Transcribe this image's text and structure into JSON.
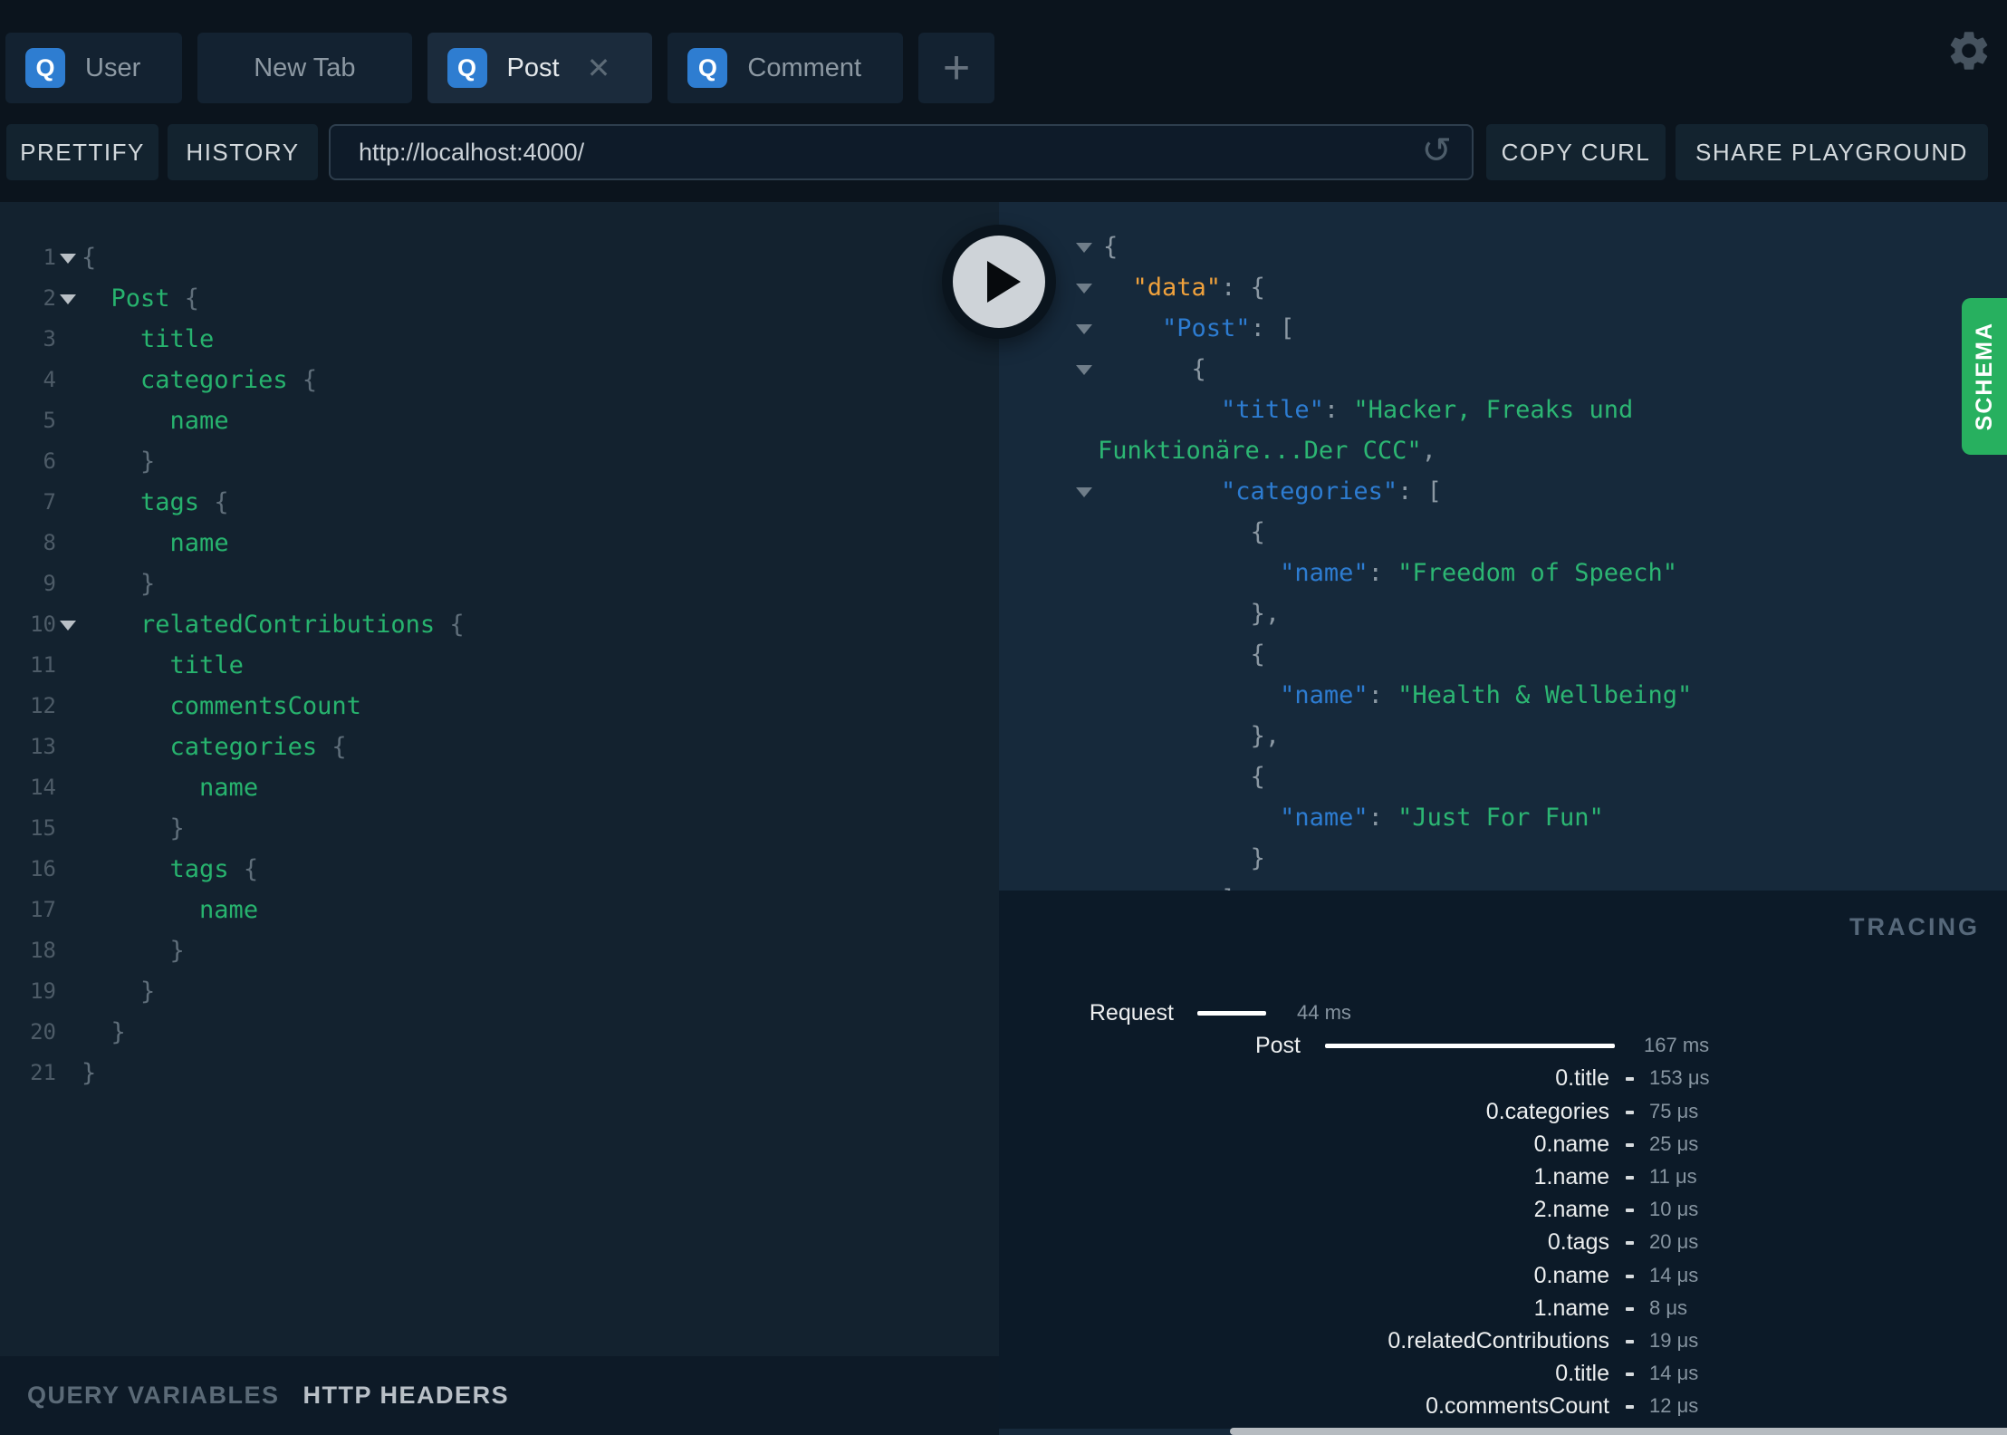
{
  "tabs": {
    "items": [
      {
        "label": "User",
        "badge": "Q",
        "closable": false,
        "active": false
      },
      {
        "label": "New Tab",
        "badge": null,
        "closable": false,
        "active": false
      },
      {
        "label": "Post",
        "badge": "Q",
        "closable": true,
        "active": true
      },
      {
        "label": "Comment",
        "badge": "Q",
        "closable": false,
        "active": false
      }
    ],
    "new_tab_button": "+"
  },
  "toolbar": {
    "prettify_label": "PRETTIFY",
    "history_label": "HISTORY",
    "url_value": "http://localhost:4000/",
    "copy_curl_label": "COPY CURL",
    "share_label": "SHARE PLAYGROUND"
  },
  "editor": {
    "lines": [
      {
        "n": 1,
        "arrow": true,
        "tokens": [
          [
            "pun",
            "{"
          ]
        ]
      },
      {
        "n": 2,
        "arrow": true,
        "tokens": [
          [
            "pln",
            "  "
          ],
          [
            "fld",
            "Post"
          ],
          [
            "pun",
            " {"
          ]
        ]
      },
      {
        "n": 3,
        "arrow": false,
        "tokens": [
          [
            "pln",
            "    "
          ],
          [
            "fld",
            "title"
          ]
        ]
      },
      {
        "n": 4,
        "arrow": false,
        "tokens": [
          [
            "pln",
            "    "
          ],
          [
            "fld",
            "categories"
          ],
          [
            "pun",
            " {"
          ]
        ]
      },
      {
        "n": 5,
        "arrow": false,
        "tokens": [
          [
            "pln",
            "      "
          ],
          [
            "fld",
            "name"
          ]
        ]
      },
      {
        "n": 6,
        "arrow": false,
        "tokens": [
          [
            "pln",
            "    "
          ],
          [
            "pun",
            "}"
          ]
        ]
      },
      {
        "n": 7,
        "arrow": false,
        "tokens": [
          [
            "pln",
            "    "
          ],
          [
            "fld",
            "tags"
          ],
          [
            "pun",
            " {"
          ]
        ]
      },
      {
        "n": 8,
        "arrow": false,
        "tokens": [
          [
            "pln",
            "      "
          ],
          [
            "fld",
            "name"
          ]
        ]
      },
      {
        "n": 9,
        "arrow": false,
        "tokens": [
          [
            "pln",
            "    "
          ],
          [
            "pun",
            "}"
          ]
        ]
      },
      {
        "n": 10,
        "arrow": true,
        "tokens": [
          [
            "pln",
            "    "
          ],
          [
            "fld",
            "relatedContributions"
          ],
          [
            "pun",
            " {"
          ]
        ]
      },
      {
        "n": 11,
        "arrow": false,
        "tokens": [
          [
            "pln",
            "      "
          ],
          [
            "fld",
            "title"
          ]
        ]
      },
      {
        "n": 12,
        "arrow": false,
        "tokens": [
          [
            "pln",
            "      "
          ],
          [
            "fld",
            "commentsCount"
          ]
        ]
      },
      {
        "n": 13,
        "arrow": false,
        "tokens": [
          [
            "pln",
            "      "
          ],
          [
            "fld",
            "categories"
          ],
          [
            "pun",
            " {"
          ]
        ]
      },
      {
        "n": 14,
        "arrow": false,
        "tokens": [
          [
            "pln",
            "        "
          ],
          [
            "fld",
            "name"
          ]
        ]
      },
      {
        "n": 15,
        "arrow": false,
        "tokens": [
          [
            "pln",
            "      "
          ],
          [
            "pun",
            "}"
          ]
        ]
      },
      {
        "n": 16,
        "arrow": false,
        "tokens": [
          [
            "pln",
            "      "
          ],
          [
            "fld",
            "tags"
          ],
          [
            "pun",
            " {"
          ]
        ]
      },
      {
        "n": 17,
        "arrow": false,
        "tokens": [
          [
            "pln",
            "        "
          ],
          [
            "fld",
            "name"
          ]
        ]
      },
      {
        "n": 18,
        "arrow": false,
        "tokens": [
          [
            "pln",
            "      "
          ],
          [
            "pun",
            "}"
          ]
        ]
      },
      {
        "n": 19,
        "arrow": false,
        "tokens": [
          [
            "pln",
            "    "
          ],
          [
            "pun",
            "}"
          ]
        ]
      },
      {
        "n": 20,
        "arrow": false,
        "tokens": [
          [
            "pln",
            "  "
          ],
          [
            "pun",
            "}"
          ]
        ]
      },
      {
        "n": 21,
        "arrow": false,
        "tokens": [
          [
            "pun",
            "}"
          ]
        ]
      }
    ]
  },
  "response": {
    "lines": [
      {
        "arrow": true,
        "wrap": false,
        "tokens": [
          [
            "pun",
            "{"
          ]
        ]
      },
      {
        "arrow": true,
        "wrap": false,
        "tokens": [
          [
            "pln",
            "  "
          ],
          [
            "dat",
            "\"data\""
          ],
          [
            "pun",
            ": {"
          ]
        ]
      },
      {
        "arrow": true,
        "wrap": false,
        "tokens": [
          [
            "pln",
            "    "
          ],
          [
            "key",
            "\"Post\""
          ],
          [
            "pun",
            ": ["
          ]
        ]
      },
      {
        "arrow": true,
        "wrap": false,
        "tokens": [
          [
            "pln",
            "      "
          ],
          [
            "pun",
            "{"
          ]
        ]
      },
      {
        "arrow": false,
        "wrap": false,
        "tokens": [
          [
            "pln",
            "        "
          ],
          [
            "key",
            "\"title\""
          ],
          [
            "pun",
            ": "
          ],
          [
            "str",
            "\"Hacker, Freaks und"
          ]
        ]
      },
      {
        "arrow": false,
        "wrap": true,
        "tokens": [
          [
            "str",
            "Funktionäre...Der CCC\""
          ],
          [
            "pun",
            ","
          ]
        ]
      },
      {
        "arrow": true,
        "wrap": false,
        "tokens": [
          [
            "pln",
            "        "
          ],
          [
            "key",
            "\"categories\""
          ],
          [
            "pun",
            ": ["
          ]
        ]
      },
      {
        "arrow": false,
        "wrap": false,
        "tokens": [
          [
            "pln",
            "          "
          ],
          [
            "pun",
            "{"
          ]
        ]
      },
      {
        "arrow": false,
        "wrap": false,
        "tokens": [
          [
            "pln",
            "            "
          ],
          [
            "key",
            "\"name\""
          ],
          [
            "pun",
            ": "
          ],
          [
            "str",
            "\"Freedom of Speech\""
          ]
        ]
      },
      {
        "arrow": false,
        "wrap": false,
        "tokens": [
          [
            "pln",
            "          "
          ],
          [
            "pun",
            "},"
          ]
        ]
      },
      {
        "arrow": false,
        "wrap": false,
        "tokens": [
          [
            "pln",
            "          "
          ],
          [
            "pun",
            "{"
          ]
        ]
      },
      {
        "arrow": false,
        "wrap": false,
        "tokens": [
          [
            "pln",
            "            "
          ],
          [
            "key",
            "\"name\""
          ],
          [
            "pun",
            ": "
          ],
          [
            "str",
            "\"Health & Wellbeing\""
          ]
        ]
      },
      {
        "arrow": false,
        "wrap": false,
        "tokens": [
          [
            "pln",
            "          "
          ],
          [
            "pun",
            "},"
          ]
        ]
      },
      {
        "arrow": false,
        "wrap": false,
        "tokens": [
          [
            "pln",
            "          "
          ],
          [
            "pun",
            "{"
          ]
        ]
      },
      {
        "arrow": false,
        "wrap": false,
        "tokens": [
          [
            "pln",
            "            "
          ],
          [
            "key",
            "\"name\""
          ],
          [
            "pun",
            ": "
          ],
          [
            "str",
            "\"Just For Fun\""
          ]
        ]
      },
      {
        "arrow": false,
        "wrap": false,
        "tokens": [
          [
            "pln",
            "          "
          ],
          [
            "pun",
            "}"
          ]
        ]
      },
      {
        "arrow": false,
        "wrap": false,
        "tokens": [
          [
            "pln",
            "        "
          ],
          [
            "pun",
            "]"
          ]
        ]
      }
    ]
  },
  "schema": {
    "label": "SCHEMA"
  },
  "tracing": {
    "title": "TRACING",
    "rows": [
      {
        "kind": "bar",
        "label": "Request",
        "value": "44 ms"
      },
      {
        "kind": "bar",
        "label": "Post",
        "value": "167 ms"
      },
      {
        "kind": "field",
        "label": "0.title",
        "value": "153 μs"
      },
      {
        "kind": "field",
        "label": "0.categories",
        "value": "75 μs"
      },
      {
        "kind": "field",
        "label": "0.name",
        "value": "25 μs"
      },
      {
        "kind": "field",
        "label": "1.name",
        "value": "11 μs"
      },
      {
        "kind": "field",
        "label": "2.name",
        "value": "10 μs"
      },
      {
        "kind": "field",
        "label": "0.tags",
        "value": "20 μs"
      },
      {
        "kind": "field",
        "label": "0.name",
        "value": "14 μs"
      },
      {
        "kind": "field",
        "label": "1.name",
        "value": "8 μs"
      },
      {
        "kind": "field",
        "label": "0.relatedContributions",
        "value": "19 μs"
      },
      {
        "kind": "field",
        "label": "0.title",
        "value": "14 μs"
      },
      {
        "kind": "field",
        "label": "0.commentsCount",
        "value": "12 μs"
      }
    ]
  },
  "footer": {
    "query_variables_label": "QUERY VARIABLES",
    "http_headers_label": "HTTP HEADERS"
  },
  "colors": {
    "accent_tab_blue": "#2e7dd1",
    "schema_green": "#27b05f",
    "field_green": "#27b36e",
    "string_green": "#2cb673",
    "key_blue": "#2d7cd1",
    "data_orange": "#efa13c",
    "editor_bg": "#13222f",
    "response_bg": "#16293b",
    "tracing_bg": "#0c1a28",
    "topbar_bg": "#0b141d"
  }
}
